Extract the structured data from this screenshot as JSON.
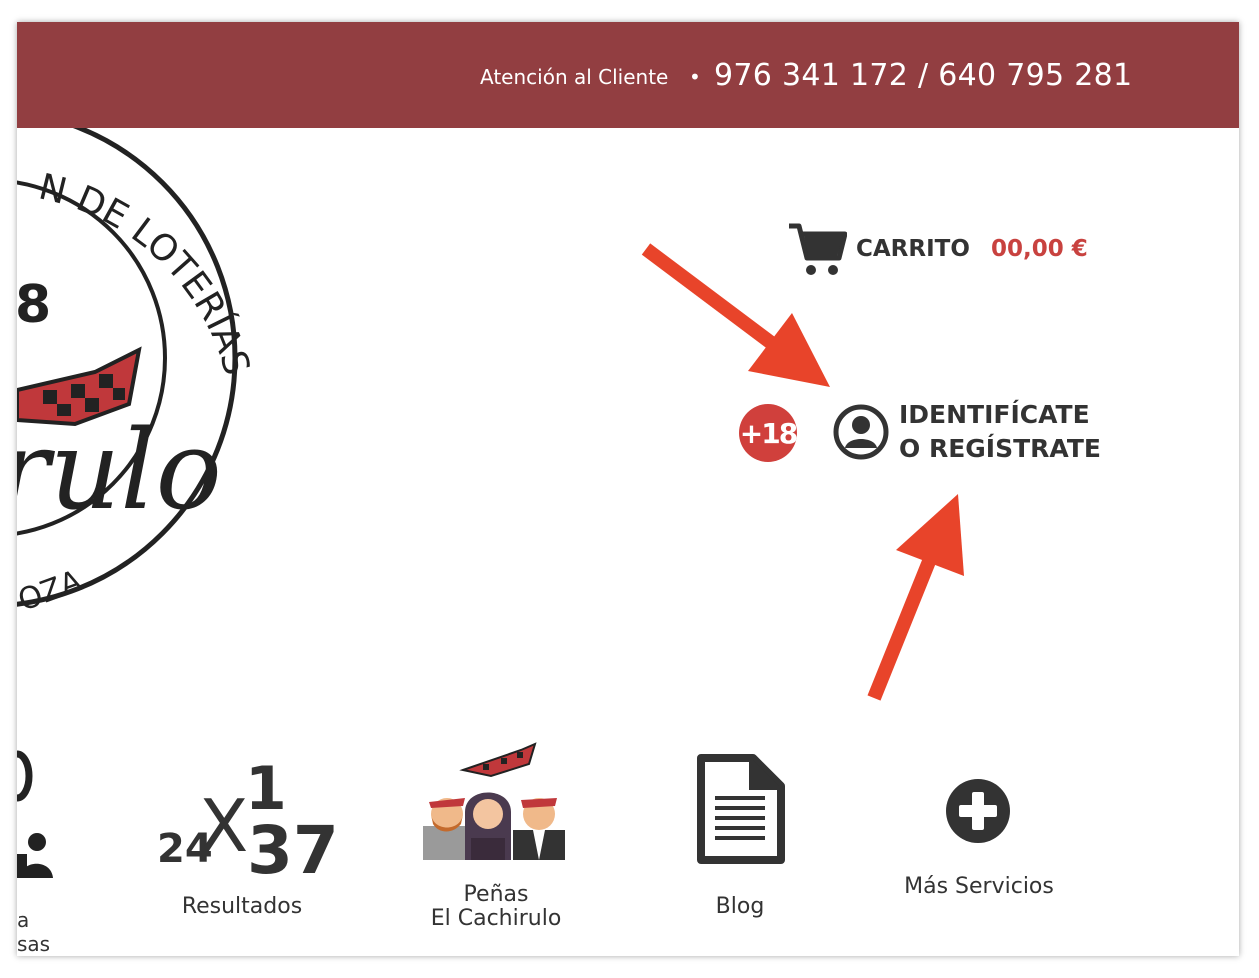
{
  "topbar": {
    "support_label": "Atención al Cliente",
    "separator": "•",
    "phones": "976 341 172 / 640 795 281",
    "background": "#923e41"
  },
  "logo": {
    "arc_text": "N DE LOTERÍAS",
    "number_fragment": "8",
    "script_fragment": "rulo",
    "bottom_fragment": "OZA"
  },
  "cart": {
    "icon": "cart-icon",
    "label": "CARRITO",
    "total": "00,00 €",
    "total_color": "#c8423f"
  },
  "age_badge": {
    "text": "+18"
  },
  "login": {
    "icon": "user-circle-icon",
    "line1": "IDENTIFÍCATE",
    "line2": "O REGÍSTRATE"
  },
  "nav": {
    "lotteries_partial": {
      "line1": "a",
      "line2": "sas"
    },
    "results": {
      "icon_numbers": {
        "a": "24",
        "x": "X",
        "b": "1",
        "c": "37"
      },
      "label": "Resultados"
    },
    "penas": {
      "line1": "Peñas",
      "line2": "El Cachirulo"
    },
    "blog": {
      "label": "Blog"
    },
    "more": {
      "label": "Más Servicios"
    }
  },
  "annotation_color": "#e8442a"
}
